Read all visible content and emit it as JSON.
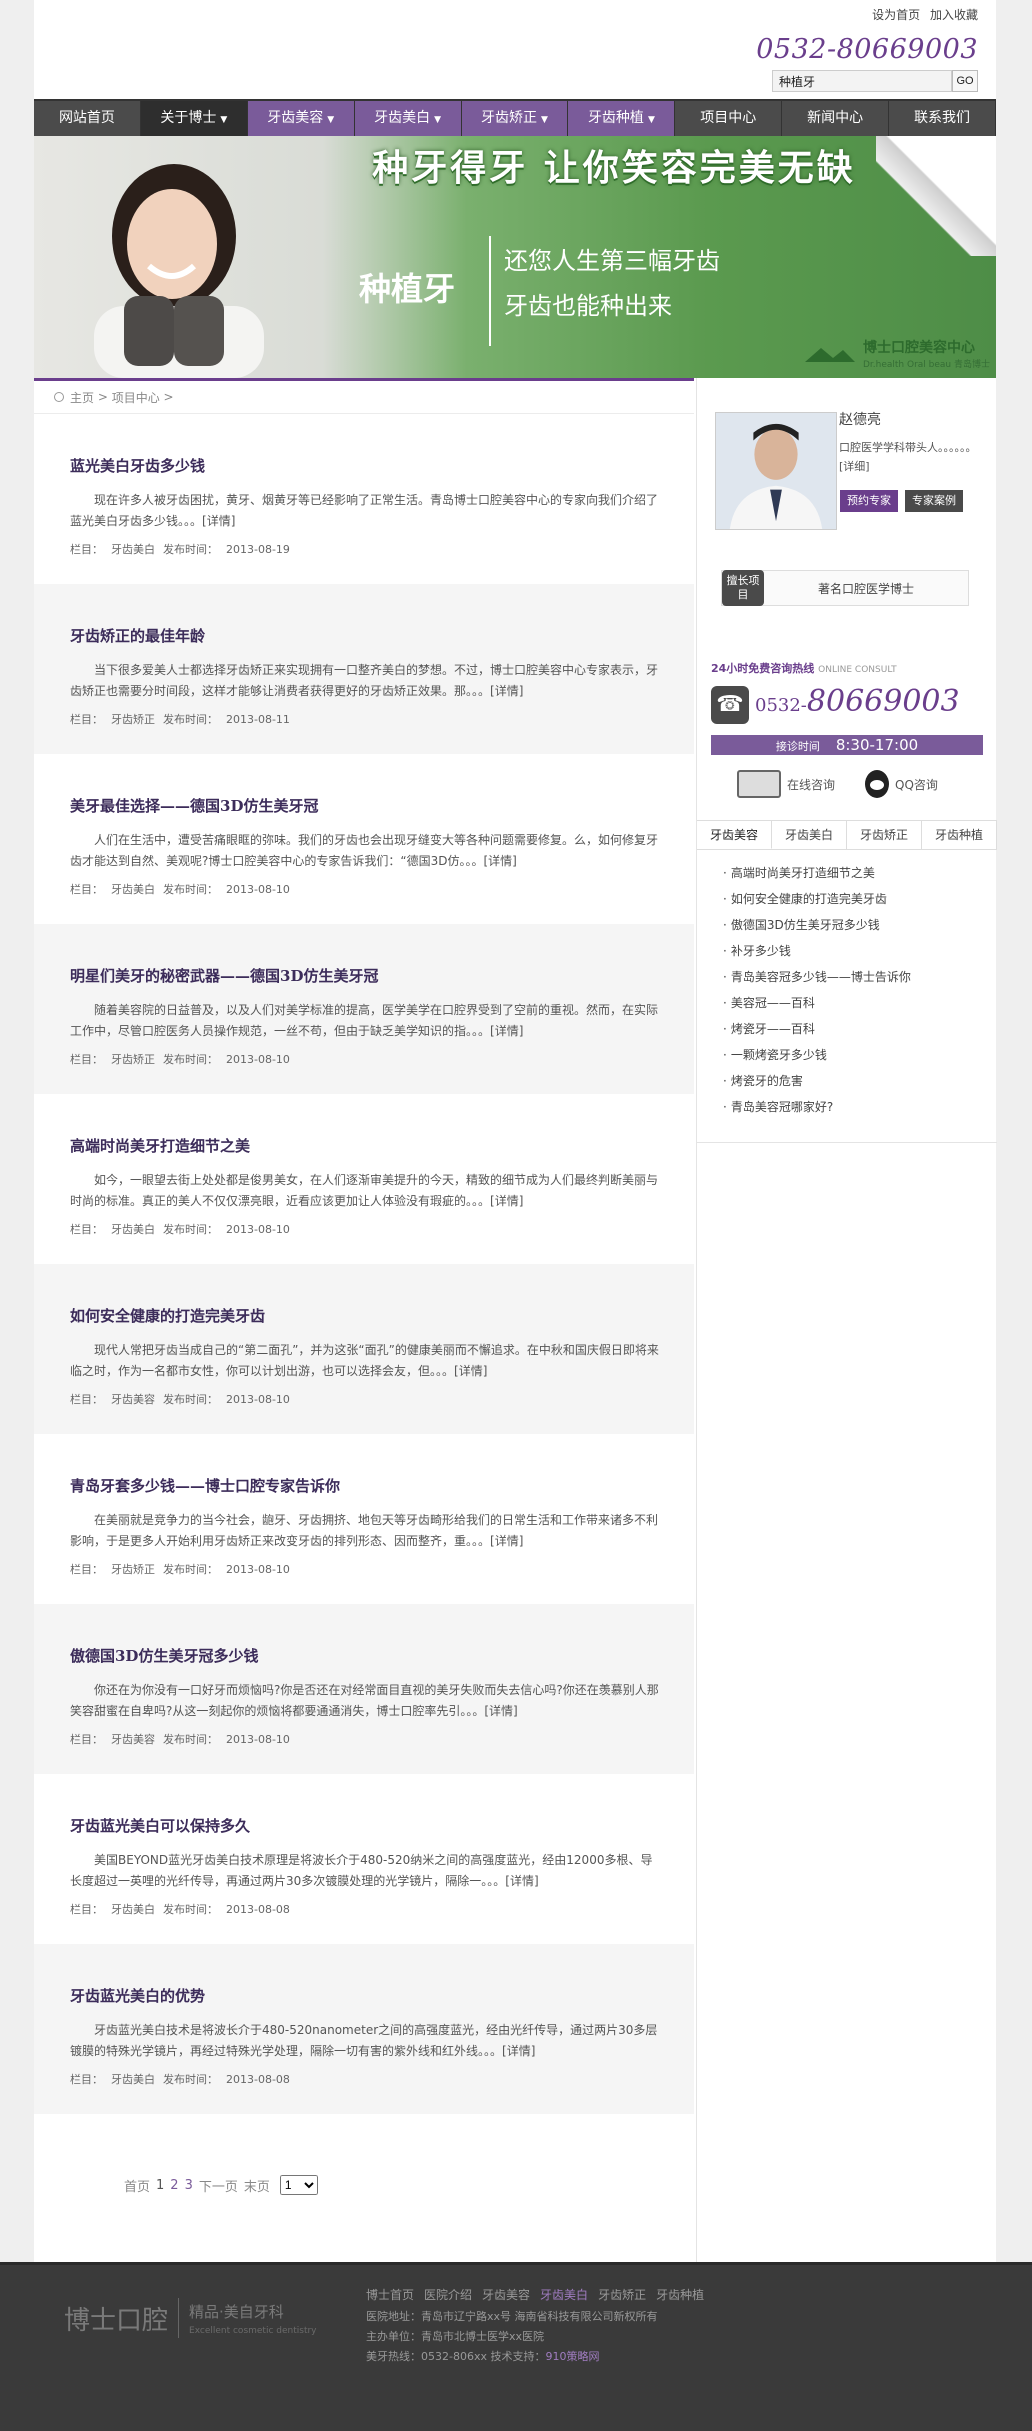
{
  "top": {
    "links": [
      "设为首页",
      "加入收藏"
    ],
    "phone": "0532-80669003",
    "search_value": "种植牙",
    "search_button": "GO"
  },
  "nav": [
    {
      "label": "网站首页",
      "caret": false,
      "style": "dark"
    },
    {
      "label": "关于博士",
      "caret": true,
      "style": "active"
    },
    {
      "label": "牙齿美容",
      "caret": true,
      "style": "purple"
    },
    {
      "label": "牙齿美白",
      "caret": true,
      "style": "purple"
    },
    {
      "label": "牙齿矫正",
      "caret": true,
      "style": "purple"
    },
    {
      "label": "牙齿种植",
      "caret": true,
      "style": "purple"
    },
    {
      "label": "项目中心",
      "caret": false,
      "style": "dark"
    },
    {
      "label": "新闻中心",
      "caret": false,
      "style": "dark"
    },
    {
      "label": "联系我们",
      "caret": false,
      "style": "dark"
    }
  ],
  "banner": {
    "slogan": "种牙得牙 让你笑容完美无缺",
    "big": "种植牙",
    "line1": "还您人生第三幅牙齿",
    "line2": "牙齿也能种出来",
    "logo_text": "博士口腔美容中心",
    "logo_sub": "Dr.health Oral beau 青岛博士"
  },
  "breadcrumb": [
    "主页",
    "项目中心"
  ],
  "articles": [
    {
      "title": "蓝光美白牙齿多少钱",
      "summary": "现在许多人被牙齿困扰，黄牙、烟黄牙等已经影响了正常生活。青岛博士口腔美容中心的专家向我们介绍了蓝光美白牙齿多少钱。。。",
      "category": "牙齿美白",
      "date": "2013-08-19"
    },
    {
      "title": "牙齿矫正的最佳年龄",
      "summary": "当下很多爱美人士都选择牙齿矫正来实现拥有一口整齐美白的梦想。不过，博士口腔美容中心专家表示，牙齿矫正也需要分时间段，这样才能够让消费者获得更好的牙齿矫正效果。那。。。",
      "category": "牙齿矫正",
      "date": "2013-08-11"
    },
    {
      "title": "美牙最佳选择——德国3D仿生美牙冠",
      "summary": "人们在生活中，遭受苦痛眼眶的弥味。我们的牙齿也会出现牙缝变大等各种问题需要修复。么，如何修复牙齿才能达到自然、美观呢?博士口腔美容中心的专家告诉我们：“德国3D仿。。。",
      "category": "牙齿美白",
      "date": "2013-08-10"
    },
    {
      "title": "明星们美牙的秘密武器——德国3D仿生美牙冠",
      "summary": "随着美容院的日益普及，以及人们对美学标准的提高，医学美学在口腔界受到了空前的重视。然而，在实际工作中，尽管口腔医务人员操作规范，一丝不苟，但由于缺乏美学知识的指。。。",
      "category": "牙齿矫正",
      "date": "2013-08-10"
    },
    {
      "title": "高端时尚美牙打造细节之美",
      "summary": "如今，一眼望去街上处处都是俊男美女，在人们逐渐审美提升的今天，精致的细节成为人们最终判断美丽与时尚的标准。真正的美人不仅仅漂亮眼，近看应该更加让人体验没有瑕疵的。。。",
      "category": "牙齿美白",
      "date": "2013-08-10"
    },
    {
      "title": "如何安全健康的打造完美牙齿",
      "summary": "现代人常把牙齿当成自己的“第二面孔”，并为这张“面孔”的健康美丽而不懈追求。在中秋和国庆假日即将来临之时，作为一名都市女性，你可以计划出游，也可以选择会友，但。。。",
      "category": "牙齿美容",
      "date": "2013-08-10"
    },
    {
      "title": "青岛牙套多少钱——博士口腔专家告诉你",
      "summary": "在美丽就是竞争力的当今社会，龅牙、牙齿拥挤、地包天等牙齿畸形给我们的日常生活和工作带来诸多不利影响，于是更多人开始利用牙齿矫正来改变牙齿的排列形态、因而整齐，重。。。",
      "category": "牙齿矫正",
      "date": "2013-08-10"
    },
    {
      "title": "傲德国3D仿生美牙冠多少钱",
      "summary": "你还在为你没有一口好牙而烦恼吗?你是否还在对经常面目直视的美牙失败而失去信心吗?你还在羡慕别人那笑容甜蜜在自卑吗?从这一刻起你的烦恼将都要通通消失，博士口腔率先引。。。",
      "category": "牙齿美容",
      "date": "2013-08-10"
    },
    {
      "title": "牙齿蓝光美白可以保持多久",
      "summary": "美国BEYOND蓝光牙齿美白技术原理是将波长介于480-520纳米之间的高强度蓝光，经由12000多根、导长度超过一英哩的光纤传导，再通过两片30多次镀膜处理的光学镜片，隔除一。。。",
      "category": "牙齿美白",
      "date": "2013-08-08"
    },
    {
      "title": "牙齿蓝光美白的优势",
      "summary": "牙齿蓝光美白技术是将波长介于480-520nanometer之间的高强度蓝光，经由光纤传导，通过两片30多层镀膜的特殊光学镜片，再经过特殊光学处理，隔除一切有害的紫外线和红外线。。。",
      "category": "牙齿美白",
      "date": "2013-08-08"
    }
  ],
  "article_labels": {
    "more": "[详情]",
    "category_prefix": "栏目：",
    "date_prefix": "发布时间："
  },
  "pager": {
    "first": "首页",
    "current": "1",
    "pages": [
      "2",
      "3"
    ],
    "next": "下一页",
    "last": "末页",
    "select_value": "1"
  },
  "sidebar": {
    "expert_name": "赵德亮",
    "expert_desc": "口腔医学学科带头人。。。。。。",
    "expert_more": "[详细]",
    "btn_book": "预约专家",
    "btn_cases": "专家案例",
    "spec_tag": "擅长项目",
    "spec_text": "著名口腔医学博士",
    "hotline_title": "24小时免费咨询热线",
    "hotline_en": "ONLINE CONSULT",
    "hotline_prefix": "0532-",
    "hotline_number": "80669003",
    "hours_label": "接诊时间",
    "hours_value": "8:30-17:00",
    "online": "在线咨询",
    "qq": "QQ咨询",
    "tabs": [
      "牙齿美容",
      "牙齿美白",
      "牙齿矫正",
      "牙齿种植"
    ],
    "links": [
      "高端时尚美牙打造细节之美",
      "如何安全健康的打造完美牙齿",
      "傲德国3D仿生美牙冠多少钱",
      "补牙多少钱",
      "青岛美容冠多少钱——博士告诉你",
      "美容冠——百科",
      "烤瓷牙——百科",
      "一颗烤瓷牙多少钱",
      "烤瓷牙的危害",
      "青岛美容冠哪家好?"
    ]
  },
  "footer": {
    "logo_main": "博士口腔",
    "logo_side": "精品·美自牙科",
    "logo_en": "Excellent cosmetic dentistry",
    "links": [
      "博士首页",
      "医院介绍",
      "牙齿美容",
      "牙齿美白",
      "牙齿矫正",
      "牙齿种植"
    ],
    "line1": "医院地址：青岛市辽宁路xx号  海南省科技有限公司新权所有",
    "line2": "主办单位：青岛市北博士医学xx医院",
    "line3_prefix": "美牙热线：0532-806xx  技术支持：",
    "line3_hl": "910策略网"
  },
  "colors": {
    "accent": "#6a3e8c",
    "nav": "#4a4a4a",
    "nav_purple": "#7a5b9a",
    "footer": "#3a3a3a"
  }
}
